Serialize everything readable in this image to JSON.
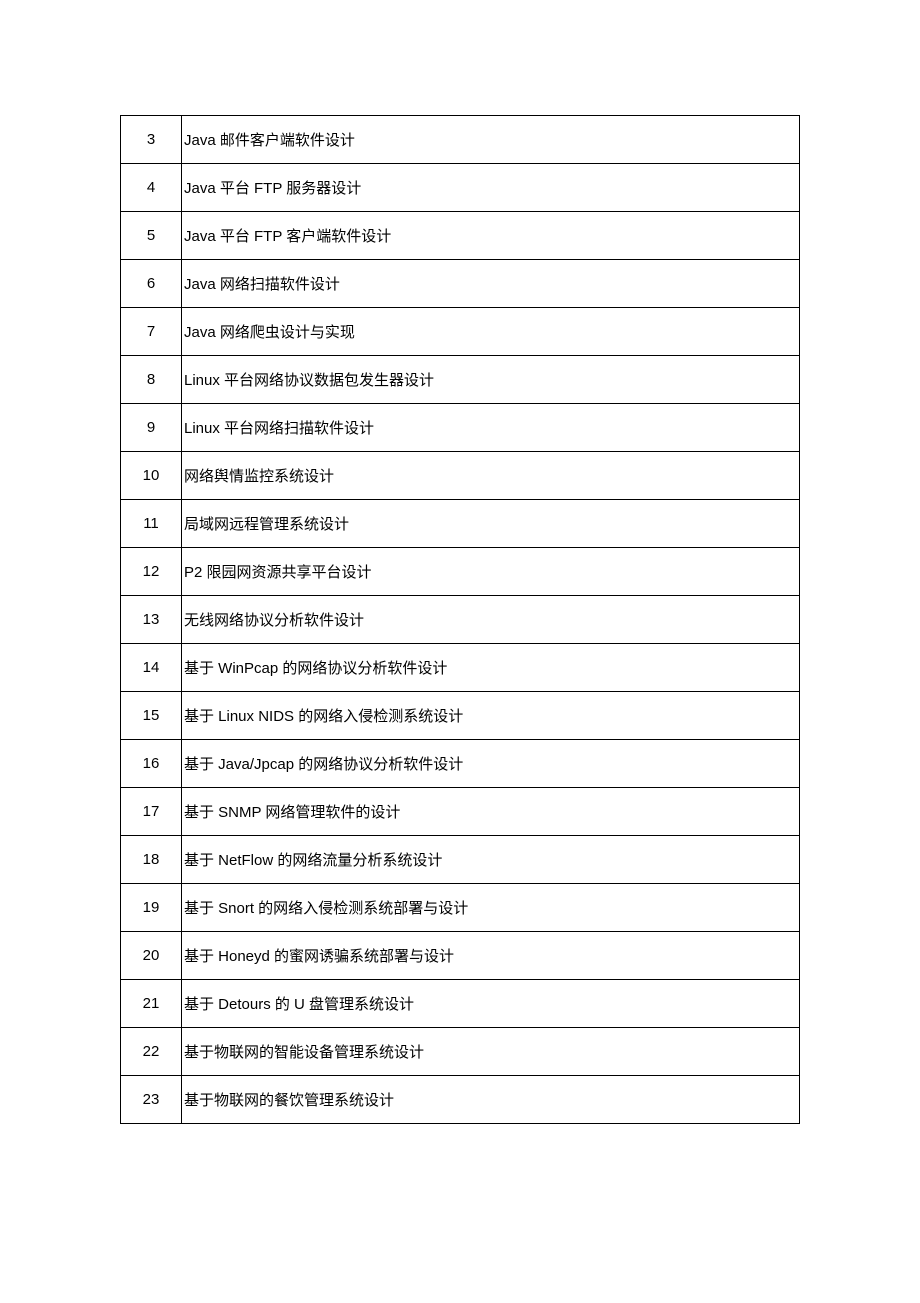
{
  "rows": [
    {
      "num": "3",
      "desc": "Java 邮件客户端软件设计"
    },
    {
      "num": "4",
      "desc": "Java 平台 FTP 服务器设计"
    },
    {
      "num": "5",
      "desc": "Java 平台 FTP 客户端软件设计"
    },
    {
      "num": "6",
      "desc": "Java 网络扫描软件设计"
    },
    {
      "num": "7",
      "desc": "Java 网络爬虫设计与实现"
    },
    {
      "num": "8",
      "desc": "Linux 平台网络协议数据包发生器设计"
    },
    {
      "num": "9",
      "desc": "Linux 平台网络扫描软件设计"
    },
    {
      "num": "10",
      "desc": "网络舆情监控系统设计"
    },
    {
      "num": "11",
      "desc": "局域网远程管理系统设计"
    },
    {
      "num": "12",
      "desc": "P2 限园网资源共享平台设计"
    },
    {
      "num": "13",
      "desc": "无线网络协议分析软件设计"
    },
    {
      "num": "14",
      "desc": "基于 WinPcap 的网络协议分析软件设计"
    },
    {
      "num": "15",
      "desc": "基于 Linux NIDS 的网络入侵检测系统设计"
    },
    {
      "num": "16",
      "desc": "基于 Java/Jpcap 的网络协议分析软件设计"
    },
    {
      "num": "17",
      "desc": "基于 SNMP 网络管理软件的设计"
    },
    {
      "num": "18",
      "desc": "基于 NetFlow 的网络流量分析系统设计"
    },
    {
      "num": "19",
      "desc": "基于 Snort 的网络入侵检测系统部署与设计"
    },
    {
      "num": "20",
      "desc": "基于 Honeyd 的蜜网诱骗系统部署与设计"
    },
    {
      "num": "21",
      "desc": "基于 Detours 的 U 盘管理系统设计"
    },
    {
      "num": "22",
      "desc": "基于物联网的智能设备管理系统设计"
    },
    {
      "num": "23",
      "desc": "基于物联网的餐饮管理系统设计"
    }
  ]
}
